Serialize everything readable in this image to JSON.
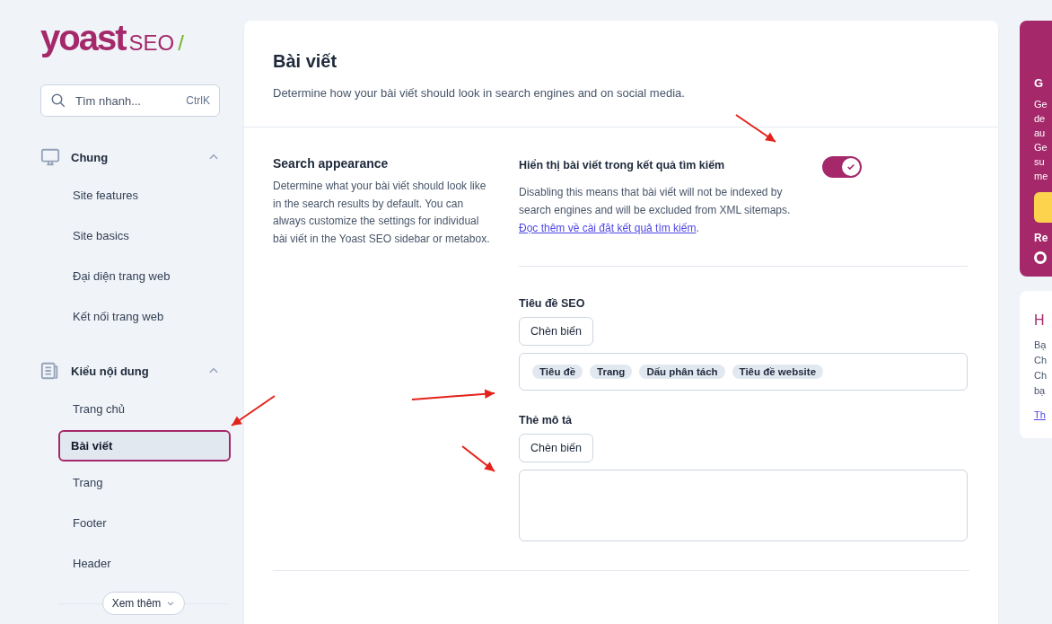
{
  "logo": {
    "word": "yoast",
    "suffix": "SEO",
    "slash": "/"
  },
  "search": {
    "placeholder": "Tìm nhanh...",
    "shortcut": "CtrlK"
  },
  "nav": [
    {
      "label": "Chung",
      "kind": "monitor",
      "expanded": true,
      "items": [
        {
          "label": "Site features",
          "selected": false
        },
        {
          "label": "Site basics",
          "selected": false
        },
        {
          "label": "Đại diện trang web",
          "selected": false
        },
        {
          "label": "Kết nối trang web",
          "selected": false
        }
      ]
    },
    {
      "label": "Kiểu nội dung",
      "kind": "newspaper",
      "expanded": true,
      "items": [
        {
          "label": "Trang chủ",
          "selected": false
        },
        {
          "label": "Bài viết",
          "selected": true
        },
        {
          "label": "Trang",
          "selected": false
        },
        {
          "label": "Footer",
          "selected": false
        },
        {
          "label": "Header",
          "selected": false
        }
      ]
    }
  ],
  "more_button": "Xem thêm",
  "page": {
    "title": "Bài viết",
    "description": "Determine how your bài viết should look in search engines and on social media."
  },
  "section": {
    "title": "Search appearance",
    "description": "Determine what your bài viết should look like in the search results by default. You can always customize the settings for individual bài viết in the Yoast SEO sidebar or metabox.",
    "toggle": {
      "label": "Hiển thị bài viết trong kết quả tìm kiếm",
      "on": true,
      "help": "Disabling this means that bài viết will not be indexed by search engines and will be excluded from XML sitemaps.",
      "link": "Đọc thêm về cài đặt kết quả tìm kiếm",
      "after_link": "."
    },
    "fields": [
      {
        "label": "Tiêu đề SEO",
        "button": "Chèn biến",
        "tags": [
          "Tiêu đề",
          "Trang",
          "Dấu phân tách",
          "Tiêu đề website"
        ]
      },
      {
        "label": "Thẻ mô tả",
        "button": "Chèn biến"
      }
    ]
  },
  "promo_card": {
    "title": "G",
    "lines": [
      "Ge",
      "de",
      "au",
      "Ge",
      "su",
      "me"
    ],
    "footer": "Re"
  },
  "help_card": {
    "title": "H",
    "lines": [
      "Bạ",
      "Ch",
      "Ch",
      "bạ"
    ],
    "link": "Th"
  }
}
